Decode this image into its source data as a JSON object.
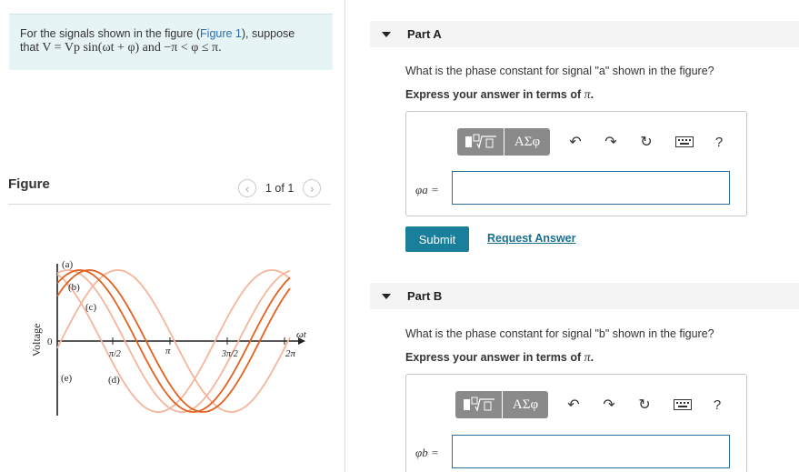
{
  "prompt": {
    "text_before": "For the signals shown in the figure (",
    "link": "Figure 1",
    "text_after": "), suppose",
    "line2_prefix": "that ",
    "equation": "V = Vp sin(ωt + φ) and −π < φ ≤ π."
  },
  "figure": {
    "title": "Figure",
    "pager": "1 of 1",
    "prev_icon": "chevron-left-icon",
    "next_icon": "chevron-right-icon",
    "y_axis_label": "Voltage",
    "zero_label": "0",
    "x_axis_label": "ωt",
    "tick_labels": [
      "π/2",
      "π",
      "3π/2",
      "2π"
    ],
    "signal_labels": [
      "(a)",
      "(b)",
      "(c)",
      "(d)",
      "(e)"
    ],
    "colors": {
      "dark": "#e3601f",
      "light": "#f5b59b"
    }
  },
  "partA": {
    "title": "Part A",
    "question": "What is the phase constant for signal \"a\" shown in the figure?",
    "instruction": "Express your answer in terms of ",
    "instruction_pi": "π",
    "answer_label": "φa =",
    "answer_value": "",
    "submit": "Submit",
    "request": "Request Answer"
  },
  "partB": {
    "title": "Part B",
    "question": "What is the phase constant for signal \"b\" shown in the figure?",
    "instruction": "Express your answer in terms of ",
    "instruction_pi": "π",
    "answer_label": "φb =",
    "answer_value": ""
  },
  "toolbar": {
    "template_icon": "template-sqrt-icon",
    "greek": "ΑΣφ",
    "undo_icon": "undo-icon",
    "redo_icon": "redo-icon",
    "reset_icon": "reset-icon",
    "keyboard_icon": "keyboard-icon",
    "help": "?"
  }
}
